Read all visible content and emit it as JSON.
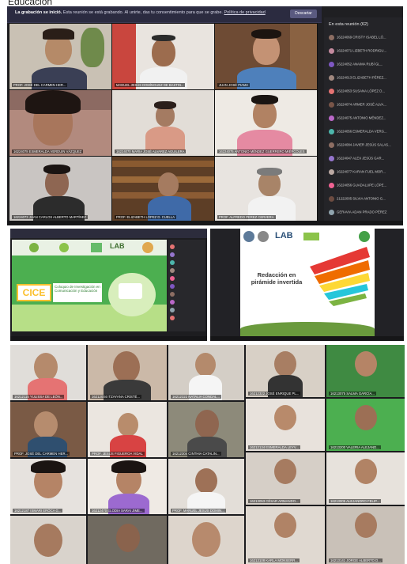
{
  "top_title": "Educación",
  "panel1": {
    "banner": {
      "bold": "La grabación se inició.",
      "text": "Esta reunión se está grabando. Al unirte, das tu consentimiento para que se grabe.",
      "link": "Política de privacidad",
      "button": "Descartar"
    },
    "sidebar_title": "En esta reunión",
    "sidebar_count": "(62)",
    "participants": [
      "16224069 CRISTY ISABEL LÓ...",
      "16224071 LIZBETH RODRIGU...",
      "16224052 ANAIMA RUBÍ GL...",
      "16224013 ELIZABETH PÉREZ...",
      "16224053 SUSANA LÓPEZ D...",
      "16224074 ARMER JOSÉ ALVA...",
      "16224075 ANTONIO MÉNDEZ...",
      "16224056 ESMERALDA VERG...",
      "16224084 JAVIER JESÚS SALAS...",
      "16224047 ALEX JESÚS GAR...",
      "16224077 KARAN FUEL MOR...",
      "16224056 GUADALUPE LÓPE...",
      "21222005 SILVIA ANTONIO G...",
      "GERAVIA ADAN PRADO PÉREZ"
    ],
    "tiles": [
      "PROF. JOSÉ DEL CARMEN HER...",
      "MANUEL JESÚS DOMÍNGUEZ DE BASTIN...",
      "JUAN JOSÉ PIAMA",
      "16224078 ESMERALDA VERDUIN VÁZQUEZ",
      "16224070 MARIA JOSÉ ALVAREZ AGUILERA",
      "16224075 ANTONIO MÉNDEZ GUERRERO MIÉRCOLES",
      "16224073 JUAN CARLOS ALBERTO MARTÍNEZ",
      "PROF. ELIZABETH LÓPEZ D. CUELLA",
      "PROF. ALFREDO PEREZ CERVERA"
    ]
  },
  "panel2": {
    "logo_text": "LAB",
    "cice_label": "CICE",
    "cice_subtitle": "Coloquio de Investigación en Comunicación y Educación"
  },
  "panel3": {
    "logo_text": "LAB",
    "slide_title": "Redacción en pirámide invertida"
  },
  "panel4": {
    "tiles": [
      "16212115 YULISSA DE LEÓN...",
      "16212004 ITZAYANA CRISTÉ...",
      "16212322 NATALIA CONDAL...",
      "16212322 JOSÉ ENRIQUE PL...",
      "16213075 SALMA GARCÍA...",
      "PROF. JOSÉ DEL CARMEN HER...",
      "PROF. JESÚS FIGUEROA VIDAL",
      "16212304 CINTHIA CATALIN...",
      "16212134 ESMERALDA LEYV...",
      "16213200 VALERIA ALEJAND...",
      "16212187 ISMARI ERÓCA G...",
      "16212470 ELODIA SARAI JIME...",
      "PROF. MANUEL JESÚS DOMIN...",
      "16213053 CÉSAR ARMANDO...",
      "16213005 ALEJANDRO FELIP...",
      "16213108 KARLA MONSERR...",
      "16213141 JORGE ALBERTO D..."
    ]
  }
}
